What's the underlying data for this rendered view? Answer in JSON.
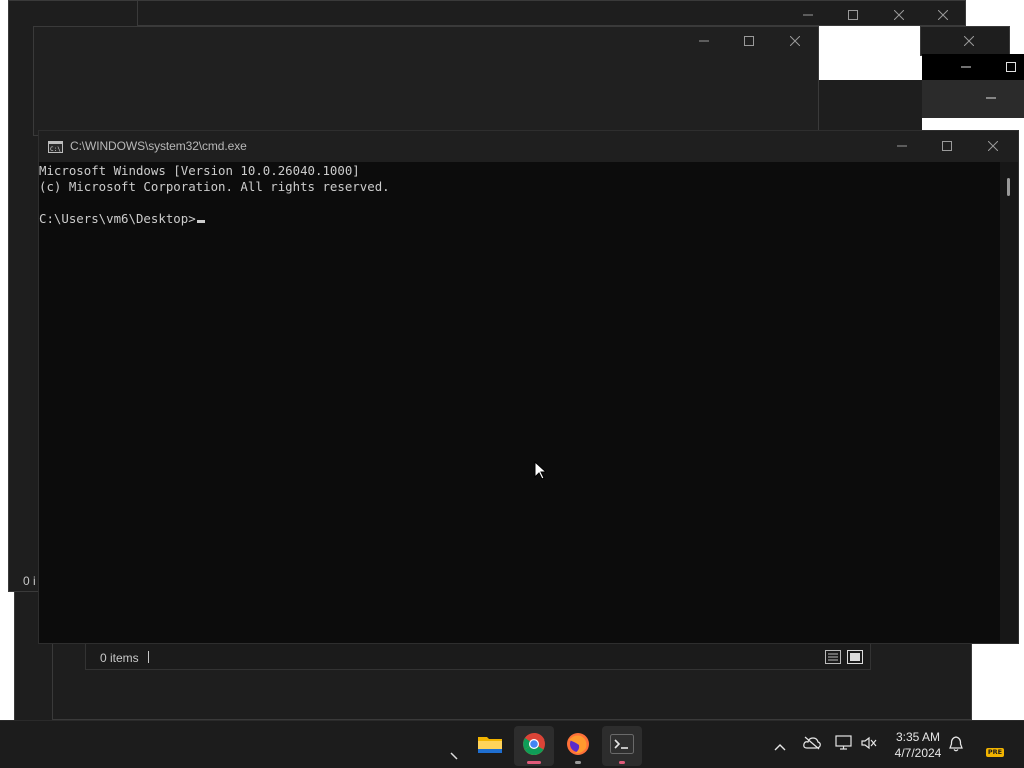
{
  "cmd": {
    "title": "C:\\WINDOWS\\system32\\cmd.exe",
    "icon": "cmd-icon",
    "lines": [
      "Microsoft Windows [Version 10.0.26040.1000]",
      "(c) Microsoft Corporation. All rights reserved.",
      "",
      "C:\\Users\\vm6\\Desktop>"
    ]
  },
  "explorer_status": {
    "items_text": "0 items",
    "items_text_partial": "0 i"
  },
  "taskbar": {
    "apps": [
      {
        "name": "File Explorer",
        "icon": "folder-icon"
      },
      {
        "name": "Google Chrome",
        "icon": "chrome-icon"
      },
      {
        "name": "Firefox",
        "icon": "firefox-icon"
      },
      {
        "name": "Terminal",
        "icon": "terminal-icon"
      }
    ],
    "clock_time": "3:35 AM",
    "clock_date": "4/7/2024",
    "pre_badge": "PRE"
  },
  "colors": {
    "window_bg": "#202020",
    "console_bg": "#0c0c0c",
    "console_text": "#cccccc",
    "taskbar_bg": "#1c1c1c",
    "chrome_indicator": "#e05a7a"
  }
}
